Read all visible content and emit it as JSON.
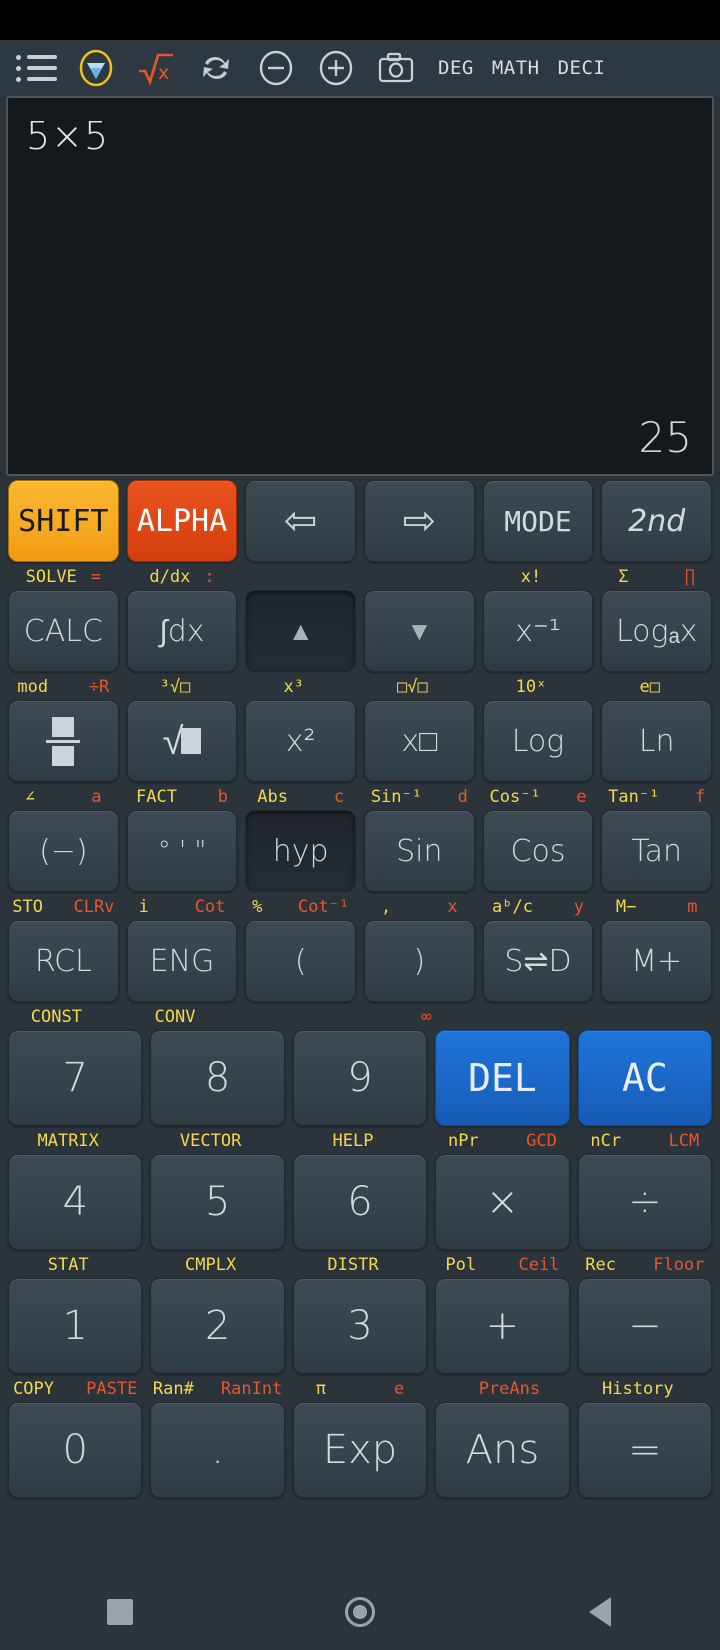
{
  "toolbar": {
    "icons": [
      {
        "name": "menu-icon",
        "label": "menu"
      },
      {
        "name": "gem-icon",
        "label": "premium"
      },
      {
        "name": "sqrt-x-icon",
        "label": "√x"
      },
      {
        "name": "refresh-icon",
        "label": "refresh"
      },
      {
        "name": "minus-circle-icon",
        "label": "zoom-out"
      },
      {
        "name": "plus-circle-icon",
        "label": "zoom-in"
      },
      {
        "name": "camera-icon",
        "label": "screenshot"
      }
    ],
    "modes": [
      "DEG",
      "MATH",
      "DECI"
    ]
  },
  "display": {
    "expression": "5×5",
    "result": "25"
  },
  "keypad": {
    "row1": {
      "keys": [
        {
          "label": "SHIFT",
          "style": "shift"
        },
        {
          "label": "ALPHA",
          "style": "alpha"
        },
        {
          "label": "⇦",
          "style": "arrow"
        },
        {
          "label": "⇨",
          "style": "arrow"
        },
        {
          "label": "MODE",
          "style": "mono"
        },
        {
          "label": "2nd",
          "style": "italic"
        }
      ]
    },
    "hint1": [
      {
        "shift": "SOLVE",
        "alpha": "="
      },
      {
        "shift": "d/dx",
        "alpha": ":"
      },
      {
        "shift": "",
        "alpha": ""
      },
      {
        "shift": "",
        "alpha": ""
      },
      {
        "shift": "x!",
        "alpha": ""
      },
      {
        "shift": "Σ",
        "alpha": "∏"
      }
    ],
    "row2": {
      "keys": [
        {
          "label": "CALC",
          "style": "normal"
        },
        {
          "label": "∫dx",
          "style": "normal"
        },
        {
          "label": "▲",
          "style": "tri",
          "pressed": true
        },
        {
          "label": "▼",
          "style": "tri"
        },
        {
          "label": "x⁻¹",
          "style": "sup"
        },
        {
          "label": "Logₐx",
          "style": "sub"
        }
      ]
    },
    "hint2": [
      {
        "shift": "mod",
        "alpha": "÷R"
      },
      {
        "shift": "³√□",
        "alpha": ""
      },
      {
        "shift": "x³",
        "alpha": ""
      },
      {
        "shift": "□√□",
        "alpha": ""
      },
      {
        "shift": "10ˣ",
        "alpha": ""
      },
      {
        "shift": "e□",
        "alpha": ""
      }
    ],
    "row3": {
      "keys": [
        {
          "label": "fraction",
          "style": "icon-frac"
        },
        {
          "label": "sqrtbox",
          "style": "icon-sqrt"
        },
        {
          "label": "x²",
          "style": "normal"
        },
        {
          "label": "x□",
          "style": "sup"
        },
        {
          "label": "Log",
          "style": "normal"
        },
        {
          "label": "Ln",
          "style": "normal"
        }
      ]
    },
    "hint3": [
      {
        "shift": "∠",
        "alpha": "a"
      },
      {
        "shift": "FACT",
        "alpha": "b"
      },
      {
        "shift": "Abs",
        "alpha": "c"
      },
      {
        "shift": "Sin⁻¹",
        "alpha": "d"
      },
      {
        "shift": "Cos⁻¹",
        "alpha": "e"
      },
      {
        "shift": "Tan⁻¹",
        "alpha": "f"
      }
    ],
    "row4": {
      "keys": [
        {
          "label": "(−)",
          "style": "normal"
        },
        {
          "label": "° ' \"",
          "style": "small"
        },
        {
          "label": "hyp",
          "style": "normal",
          "pressed": true
        },
        {
          "label": "Sin",
          "style": "normal"
        },
        {
          "label": "Cos",
          "style": "normal"
        },
        {
          "label": "Tan",
          "style": "normal"
        }
      ]
    },
    "hint4": [
      {
        "shift": "STO",
        "alpha": "CLRv"
      },
      {
        "shift": "i",
        "alpha": "Cot"
      },
      {
        "shift": "%",
        "alpha": "Cot⁻¹"
      },
      {
        "shift": ",",
        "alpha": "x"
      },
      {
        "shift": "aᵇ/c",
        "alpha": "y"
      },
      {
        "shift": "M−",
        "alpha": "m"
      }
    ],
    "row5": {
      "keys": [
        {
          "label": "RCL",
          "style": "normal"
        },
        {
          "label": "ENG",
          "style": "normal"
        },
        {
          "label": "(",
          "style": "normal"
        },
        {
          "label": ")",
          "style": "normal"
        },
        {
          "label": "S⇌D",
          "style": "normal"
        },
        {
          "label": "M+",
          "style": "normal"
        }
      ]
    },
    "hint5": [
      {
        "shift": "CONST",
        "alpha": ""
      },
      {
        "shift": "CONV",
        "alpha": ""
      },
      {
        "shift": "",
        "alpha": ""
      },
      {
        "shift": "",
        "alpha": "∞"
      },
      {
        "shift": "",
        "alpha": ""
      },
      {
        "shift": "",
        "alpha": ""
      }
    ],
    "row6": {
      "keys": [
        {
          "label": "7",
          "style": "num"
        },
        {
          "label": "8",
          "style": "num"
        },
        {
          "label": "9",
          "style": "num"
        },
        {
          "label": "DEL",
          "style": "blue"
        },
        {
          "label": "AC",
          "style": "blue"
        }
      ]
    },
    "hint6": [
      {
        "shift": "MATRIX",
        "alpha": ""
      },
      {
        "shift": "VECTOR",
        "alpha": ""
      },
      {
        "shift": "HELP",
        "alpha": ""
      },
      {
        "shift": "nPr",
        "alpha": "GCD"
      },
      {
        "shift": "nCr",
        "alpha": "LCM"
      }
    ],
    "row7": {
      "keys": [
        {
          "label": "4",
          "style": "num"
        },
        {
          "label": "5",
          "style": "num"
        },
        {
          "label": "6",
          "style": "num"
        },
        {
          "label": "×",
          "style": "num"
        },
        {
          "label": "÷",
          "style": "num"
        }
      ]
    },
    "hint7": [
      {
        "shift": "STAT",
        "alpha": ""
      },
      {
        "shift": "CMPLX",
        "alpha": ""
      },
      {
        "shift": "DISTR",
        "alpha": ""
      },
      {
        "shift": "Pol",
        "alpha": "Ceil"
      },
      {
        "shift": "Rec",
        "alpha": "Floor"
      }
    ],
    "row8": {
      "keys": [
        {
          "label": "1",
          "style": "num"
        },
        {
          "label": "2",
          "style": "num"
        },
        {
          "label": "3",
          "style": "num"
        },
        {
          "label": "+",
          "style": "num"
        },
        {
          "label": "−",
          "style": "num"
        }
      ]
    },
    "hint8": [
      {
        "shift": "COPY",
        "alpha": "PASTE"
      },
      {
        "shift": "Ran#",
        "alpha": "RanInt"
      },
      {
        "shift": "π",
        "alpha": "e"
      },
      {
        "shift": "",
        "alpha": "PreAns"
      },
      {
        "shift": "History",
        "alpha": ""
      }
    ],
    "row9": {
      "keys": [
        {
          "label": "0",
          "style": "num"
        },
        {
          "label": ".",
          "style": "num"
        },
        {
          "label": "Exp",
          "style": "num"
        },
        {
          "label": "Ans",
          "style": "num"
        },
        {
          "label": "=",
          "style": "num"
        }
      ]
    }
  },
  "navbar": {
    "buttons": [
      {
        "name": "recents-button",
        "label": "recents"
      },
      {
        "name": "home-button",
        "label": "home"
      },
      {
        "name": "back-button",
        "label": "back"
      }
    ]
  },
  "colors": {
    "shift_yellow": "#f5d847",
    "alpha_orange": "#e8552a",
    "accent_blue": "#1f74d8",
    "panel": "#2b343b",
    "key": "#3a464f"
  }
}
